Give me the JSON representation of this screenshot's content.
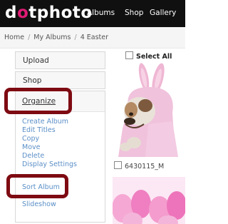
{
  "header": {
    "logo_pre": "d",
    "logo_mid": "o",
    "logo_post": "tphoto",
    "nav": [
      "Albums",
      "Shop",
      "Gallery"
    ]
  },
  "breadcrumb": {
    "items": [
      "Home",
      "My Albums",
      "4 Easter"
    ],
    "separator": "/"
  },
  "sidebar": {
    "upload": "Upload",
    "shop": "Shop",
    "organize": {
      "title": "Organize",
      "items": [
        "Create Album",
        "Edit Titles",
        "Copy",
        "Move",
        "Delete",
        "Display Settings",
        "Sort Album",
        "Slideshow"
      ]
    }
  },
  "photos": {
    "select_all": "Select All",
    "items": [
      {
        "caption": "6430115_M"
      }
    ]
  },
  "colors": {
    "topbar": "#101010",
    "brand_accent": "#e11b75",
    "link": "#5b8fc7",
    "highlight": "#7e0a12"
  }
}
